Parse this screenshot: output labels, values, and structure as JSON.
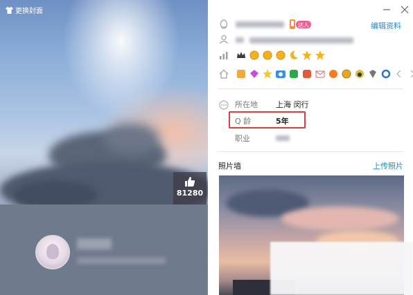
{
  "cover": {
    "change_cover_label": "更换封面",
    "like_count": "81280"
  },
  "profile": {
    "edit_label": "编辑资料",
    "daren_label": "达人",
    "info": [
      {
        "label": "所在地",
        "value": "上海 闵行"
      },
      {
        "label": "Q 龄",
        "value": "5年"
      },
      {
        "label": "职业",
        "value": ""
      }
    ]
  },
  "photo_wall": {
    "title": "照片墙",
    "upload_label": "上传照片"
  },
  "colors": {
    "link": "#1e8bd6",
    "highlight": "#e03b3b"
  },
  "icons": [
    "shirt-icon",
    "thumbs-up-icon",
    "minimize-icon",
    "close-icon",
    "qq-penguin-icon",
    "person-icon",
    "level-chart-icon",
    "home-icon",
    "more-dots-icon",
    "arrow-left-icon",
    "arrow-right-icon"
  ]
}
